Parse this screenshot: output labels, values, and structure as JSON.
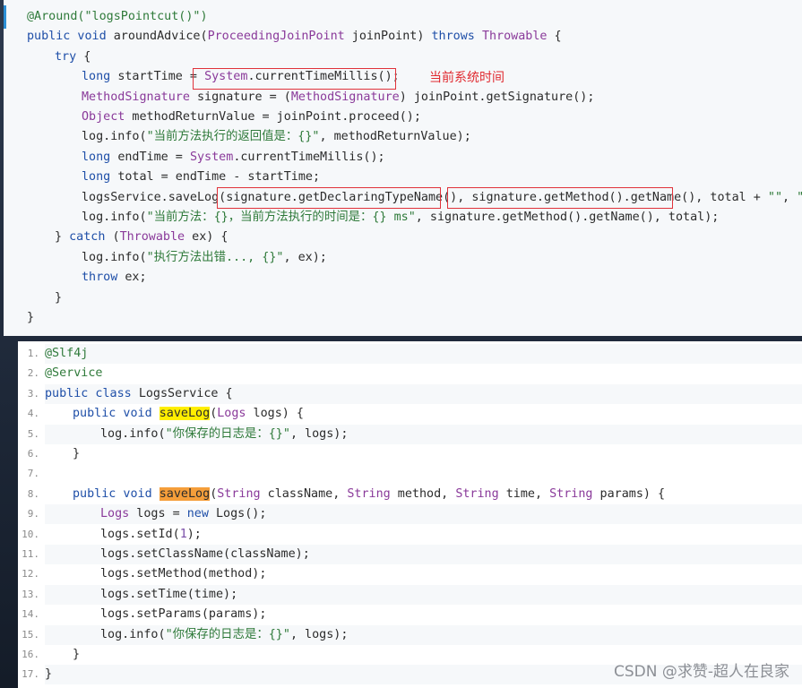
{
  "top_code": {
    "annotation_note": "当前系统时间",
    "lines": [
      {
        "indent": 0,
        "tokens": [
          {
            "t": "@Around(",
            "c": "an"
          },
          {
            "t": "\"logsPointcut()\"",
            "c": "st"
          },
          {
            "t": ")",
            "c": "an"
          }
        ]
      },
      {
        "indent": 0,
        "tokens": [
          {
            "t": "public void ",
            "c": "kw"
          },
          {
            "t": "aroundAdvice(",
            "c": ""
          },
          {
            "t": "ProceedingJoinPoint",
            "c": "ty"
          },
          {
            "t": " joinPoint) ",
            "c": ""
          },
          {
            "t": "throws ",
            "c": "kw"
          },
          {
            "t": "Throwable",
            "c": "ty"
          },
          {
            "t": " {",
            "c": ""
          }
        ]
      },
      {
        "indent": 1,
        "tokens": [
          {
            "t": "try",
            "c": "kw"
          },
          {
            "t": " {",
            "c": ""
          }
        ]
      },
      {
        "indent": 2,
        "tokens": [
          {
            "t": "long ",
            "c": "kw"
          },
          {
            "t": "startTime = ",
            "c": ""
          },
          {
            "t": "System",
            "c": "ty"
          },
          {
            "t": ".currentTimeMillis();",
            "c": ""
          }
        ]
      },
      {
        "indent": 2,
        "tokens": [
          {
            "t": "MethodSignature",
            "c": "ty"
          },
          {
            "t": " signature = (",
            "c": ""
          },
          {
            "t": "MethodSignature",
            "c": "ty"
          },
          {
            "t": ") joinPoint.getSignature();",
            "c": ""
          }
        ]
      },
      {
        "indent": 2,
        "tokens": [
          {
            "t": "Object",
            "c": "ty"
          },
          {
            "t": " methodReturnValue = joinPoint.proceed();",
            "c": ""
          }
        ]
      },
      {
        "indent": 2,
        "tokens": [
          {
            "t": "log.info(",
            "c": ""
          },
          {
            "t": "\"当前方法执行的返回值是：{}\"",
            "c": "st"
          },
          {
            "t": ", methodReturnValue);",
            "c": ""
          }
        ]
      },
      {
        "indent": 2,
        "tokens": [
          {
            "t": "long ",
            "c": "kw"
          },
          {
            "t": "endTime = ",
            "c": ""
          },
          {
            "t": "System",
            "c": "ty"
          },
          {
            "t": ".currentTimeMillis();",
            "c": ""
          }
        ]
      },
      {
        "indent": 2,
        "tokens": [
          {
            "t": "long ",
            "c": "kw"
          },
          {
            "t": "total = endTime - startTime;",
            "c": ""
          }
        ]
      },
      {
        "indent": 2,
        "tokens": [
          {
            "t": "logsService.saveLog(signature.getDeclaringTypeName(), signature.getMethod().getName(), total + ",
            "c": ""
          },
          {
            "t": "\"\"",
            "c": "st"
          },
          {
            "t": ", ",
            "c": ""
          },
          {
            "t": "\"\"",
            "c": "st"
          },
          {
            "t": ");",
            "c": ""
          }
        ]
      },
      {
        "indent": 2,
        "tokens": [
          {
            "t": "log.info(",
            "c": ""
          },
          {
            "t": "\"当前方法：{}，当前方法执行的时间是：{} ms\"",
            "c": "st"
          },
          {
            "t": ", signature.getMethod().getName(), total);",
            "c": ""
          }
        ]
      },
      {
        "indent": 1,
        "tokens": [
          {
            "t": "} ",
            "c": ""
          },
          {
            "t": "catch",
            "c": "kw"
          },
          {
            "t": " (",
            "c": ""
          },
          {
            "t": "Throwable",
            "c": "ty"
          },
          {
            "t": " ex) {",
            "c": ""
          }
        ]
      },
      {
        "indent": 2,
        "tokens": [
          {
            "t": "log.info(",
            "c": ""
          },
          {
            "t": "\"执行方法出错..., {}\"",
            "c": "st"
          },
          {
            "t": ", ex);",
            "c": ""
          }
        ]
      },
      {
        "indent": 2,
        "tokens": [
          {
            "t": "throw",
            "c": "kw"
          },
          {
            "t": " ex;",
            "c": ""
          }
        ]
      },
      {
        "indent": 1,
        "tokens": [
          {
            "t": "}",
            "c": ""
          }
        ]
      },
      {
        "indent": 0,
        "tokens": [
          {
            "t": "}",
            "c": ""
          }
        ]
      }
    ]
  },
  "bottom_code": {
    "lines": [
      {
        "num": "1.",
        "indent": 0,
        "tokens": [
          {
            "t": "@Slf4j",
            "c": "an"
          }
        ]
      },
      {
        "num": "2.",
        "indent": 0,
        "tokens": [
          {
            "t": "@Service",
            "c": "an"
          }
        ]
      },
      {
        "num": "3.",
        "indent": 0,
        "tokens": [
          {
            "t": "public class ",
            "c": "kw"
          },
          {
            "t": "LogsService {",
            "c": ""
          }
        ]
      },
      {
        "num": "4.",
        "indent": 1,
        "tokens": [
          {
            "t": "public void ",
            "c": "kw"
          },
          {
            "t": "saveLog",
            "c": "",
            "hl": "yellow"
          },
          {
            "t": "(",
            "c": ""
          },
          {
            "t": "Logs",
            "c": "ty"
          },
          {
            "t": " logs) {",
            "c": ""
          }
        ]
      },
      {
        "num": "5.",
        "indent": 2,
        "tokens": [
          {
            "t": "log.info(",
            "c": ""
          },
          {
            "t": "\"你保存的日志是：{}\"",
            "c": "st"
          },
          {
            "t": ", logs);",
            "c": ""
          }
        ]
      },
      {
        "num": "6.",
        "indent": 1,
        "tokens": [
          {
            "t": "}",
            "c": ""
          }
        ]
      },
      {
        "num": "7.",
        "indent": 0,
        "tokens": []
      },
      {
        "num": "8.",
        "indent": 1,
        "tokens": [
          {
            "t": "public void ",
            "c": "kw"
          },
          {
            "t": "saveLog",
            "c": "",
            "hl": "orange"
          },
          {
            "t": "(",
            "c": ""
          },
          {
            "t": "String",
            "c": "ty"
          },
          {
            "t": " className, ",
            "c": ""
          },
          {
            "t": "String",
            "c": "ty"
          },
          {
            "t": " method, ",
            "c": ""
          },
          {
            "t": "String",
            "c": "ty"
          },
          {
            "t": " time, ",
            "c": ""
          },
          {
            "t": "String",
            "c": "ty"
          },
          {
            "t": " params) {",
            "c": ""
          }
        ]
      },
      {
        "num": "9.",
        "indent": 2,
        "tokens": [
          {
            "t": "Logs",
            "c": "ty"
          },
          {
            "t": " logs = ",
            "c": ""
          },
          {
            "t": "new",
            "c": "kw"
          },
          {
            "t": " Logs();",
            "c": ""
          }
        ]
      },
      {
        "num": "10.",
        "indent": 2,
        "tokens": [
          {
            "t": "logs.setId(",
            "c": ""
          },
          {
            "t": "1",
            "c": "nu"
          },
          {
            "t": ");",
            "c": ""
          }
        ]
      },
      {
        "num": "11.",
        "indent": 2,
        "tokens": [
          {
            "t": "logs.setClassName(className);",
            "c": ""
          }
        ]
      },
      {
        "num": "12.",
        "indent": 2,
        "tokens": [
          {
            "t": "logs.setMethod(method);",
            "c": ""
          }
        ]
      },
      {
        "num": "13.",
        "indent": 2,
        "tokens": [
          {
            "t": "logs.setTime(time);",
            "c": ""
          }
        ]
      },
      {
        "num": "14.",
        "indent": 2,
        "tokens": [
          {
            "t": "logs.setParams(params);",
            "c": ""
          }
        ]
      },
      {
        "num": "15.",
        "indent": 2,
        "tokens": [
          {
            "t": "log.info(",
            "c": ""
          },
          {
            "t": "\"你保存的日志是：{}\"",
            "c": "st"
          },
          {
            "t": ", logs);",
            "c": ""
          }
        ]
      },
      {
        "num": "16.",
        "indent": 1,
        "tokens": [
          {
            "t": "}",
            "c": ""
          }
        ]
      },
      {
        "num": "17.",
        "indent": 0,
        "tokens": [
          {
            "t": "}",
            "c": ""
          }
        ]
      }
    ]
  },
  "watermark": "CSDN @求赞-超人在良家",
  "colors": {
    "keyword": "#1f4fa8",
    "type": "#8a3a9a",
    "string": "#2f7a3a",
    "annotation_red": "#e02a30",
    "highlight_yellow": "#ffee00",
    "highlight_orange": "#f59e3a"
  }
}
